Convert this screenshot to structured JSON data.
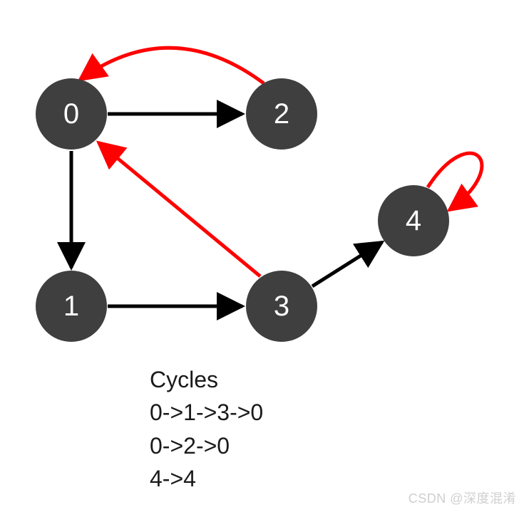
{
  "nodes": {
    "n0": {
      "label": "0"
    },
    "n1": {
      "label": "1"
    },
    "n2": {
      "label": "2"
    },
    "n3": {
      "label": "3"
    },
    "n4": {
      "label": "4"
    }
  },
  "edges": [
    {
      "from": 0,
      "to": 2,
      "color": "black"
    },
    {
      "from": 2,
      "to": 0,
      "color": "red"
    },
    {
      "from": 0,
      "to": 1,
      "color": "black"
    },
    {
      "from": 1,
      "to": 3,
      "color": "black"
    },
    {
      "from": 3,
      "to": 0,
      "color": "red"
    },
    {
      "from": 3,
      "to": 4,
      "color": "black"
    },
    {
      "from": 4,
      "to": 4,
      "color": "red"
    }
  ],
  "cycles": {
    "heading": "Cycles",
    "c1": "0->1->3->0",
    "c2": "0->2->0",
    "c3": "4->4"
  },
  "watermark": "CSDN @深度混淆",
  "chart_data": {
    "type": "diagram",
    "graph_type": "directed",
    "nodes": [
      0,
      1,
      2,
      3,
      4
    ],
    "edges": [
      {
        "from": 0,
        "to": 2,
        "color": "#000000"
      },
      {
        "from": 2,
        "to": 0,
        "color": "#ff0000"
      },
      {
        "from": 0,
        "to": 1,
        "color": "#000000"
      },
      {
        "from": 1,
        "to": 3,
        "color": "#000000"
      },
      {
        "from": 3,
        "to": 0,
        "color": "#ff0000"
      },
      {
        "from": 3,
        "to": 4,
        "color": "#000000"
      },
      {
        "from": 4,
        "to": 4,
        "color": "#ff0000"
      }
    ],
    "cycles": [
      [
        0,
        1,
        3,
        0
      ],
      [
        0,
        2,
        0
      ],
      [
        4,
        4
      ]
    ],
    "title": "Cycles",
    "annotations": [
      "0->1->3->0",
      "0->2->0",
      "4->4"
    ]
  }
}
